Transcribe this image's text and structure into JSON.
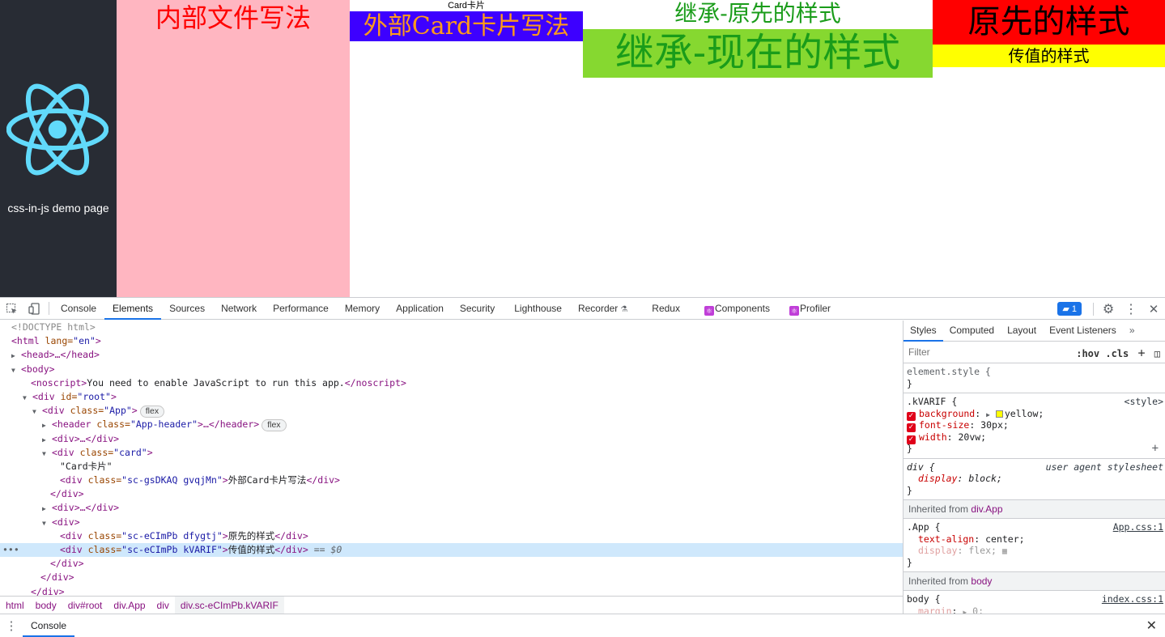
{
  "page": {
    "header_text": "css-in-js demo page",
    "pink_text": "内部文件写法",
    "card_label": "Card卡片",
    "card_inner": "外部Card卡片写法",
    "inherit_old": "继承-原先的样式",
    "inherit_new": "继承-现在的样式",
    "orig_style": "原先的样式",
    "passed_style": "传值的样式",
    "colors": {
      "header_bg": "#282c34",
      "react": "#61dafb",
      "pink": "#ffb6c1",
      "card_bg": "#3d00ff",
      "green": "#86d830",
      "red": "#ff0000",
      "yellow": "#ffff00"
    }
  },
  "devtools": {
    "tabs": [
      "Console",
      "Elements",
      "Sources",
      "Network",
      "Performance",
      "Memory",
      "Application",
      "Security",
      "Lighthouse",
      "Recorder",
      "Redux",
      "Components",
      "Profiler"
    ],
    "active_tab": "Elements",
    "message_count": "1",
    "dom": {
      "doctype": "<!DOCTYPE html>",
      "l_html_tag": "<html",
      "l_html_attr": " lang=",
      "l_html_val": "\"en\"",
      "l_head": "<head>…</head>",
      "l_body": "<body>",
      "l_noscript_open": "<noscript>",
      "l_noscript_text": "You need to enable JavaScript to run this app.",
      "l_noscript_close": "</noscript>",
      "l_root_attr": " id=",
      "l_root_val": "\"root\"",
      "l_app_attr": " class=",
      "l_app_val": "\"App\"",
      "flex": "flex",
      "l_header_val": "\"App-header\"",
      "l_header_end": ">…</header>",
      "l_div_collapsed": "<div>…</div>",
      "l_card_val": "\"card\"",
      "l_card_text": "\"Card卡片\"",
      "l_sc1_val": "\"sc-gsDKAQ gvqjMn\"",
      "l_sc1_text": "外部Card卡片写法",
      "l_div_close": "</div>",
      "l_div_open": "<div>",
      "l_sc2_val": "\"sc-eCImPb dfygtj\"",
      "l_sc2_text": "原先的样式",
      "l_sc3_val": "\"sc-eCImPb kVARIF\"",
      "l_sc3_text": "传值的样式",
      "l_eq": " == ",
      "l_dollar": "$0"
    },
    "breadcrumb": [
      "html",
      "body",
      "div#root",
      "div.App",
      "div",
      "div.sc-eCImPb.kVARIF"
    ],
    "styles_tabs": [
      "Styles",
      "Computed",
      "Layout",
      "Event Listeners"
    ],
    "filter_placeholder": "Filter",
    "filter_buttons": ":hov .cls",
    "element_style": "element.style {",
    "rule1": {
      "selector": ".kVARIF {",
      "source": "<style>",
      "p1": "background",
      "v1": "yellow;",
      "p2": "font-size",
      "v2": "30px;",
      "p3": "width",
      "v3": "20vw;"
    },
    "rule2": {
      "selector": "div {",
      "source": "user agent stylesheet",
      "p1": "display",
      "v1": "block;"
    },
    "inherited_app_label": "Inherited from",
    "inherited_app_sel": "div.App",
    "rule3": {
      "selector": ".App {",
      "source": "App.css:1",
      "p1": "text-align",
      "v1": "center;",
      "p2": "display",
      "v2": "flex;"
    },
    "inherited_body_label": "Inherited from",
    "inherited_body_sel": "body",
    "rule4": {
      "selector": "body {",
      "source": "index.css:1",
      "p1": "margin",
      "v1": "0;"
    },
    "close_brace": "}",
    "drawer_tab": "Console"
  }
}
